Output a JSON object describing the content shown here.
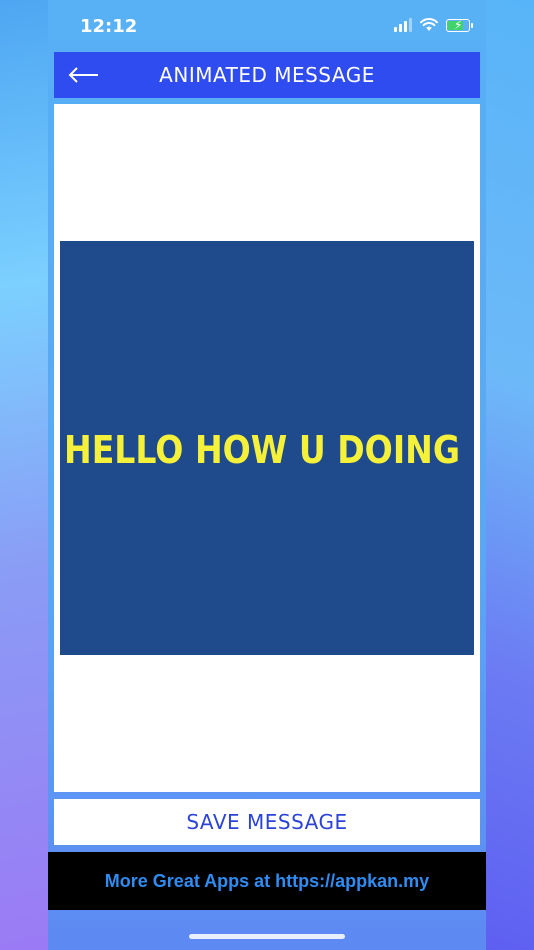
{
  "status_bar": {
    "time": "12:12"
  },
  "header": {
    "title": "ANIMATED MESSAGE",
    "back_icon": "arrow-left-icon"
  },
  "preview": {
    "message": "HELLO HOW U DOING",
    "background_color": "#1f4a8c",
    "text_color": "#f5f03a"
  },
  "actions": {
    "save_label": "SAVE MESSAGE"
  },
  "footer": {
    "text": "More Great Apps at https://appkan.my"
  },
  "colors": {
    "header_bg": "#2f4cf0",
    "accent_text": "#2b43d9",
    "footer_text": "#2f8cf2"
  }
}
